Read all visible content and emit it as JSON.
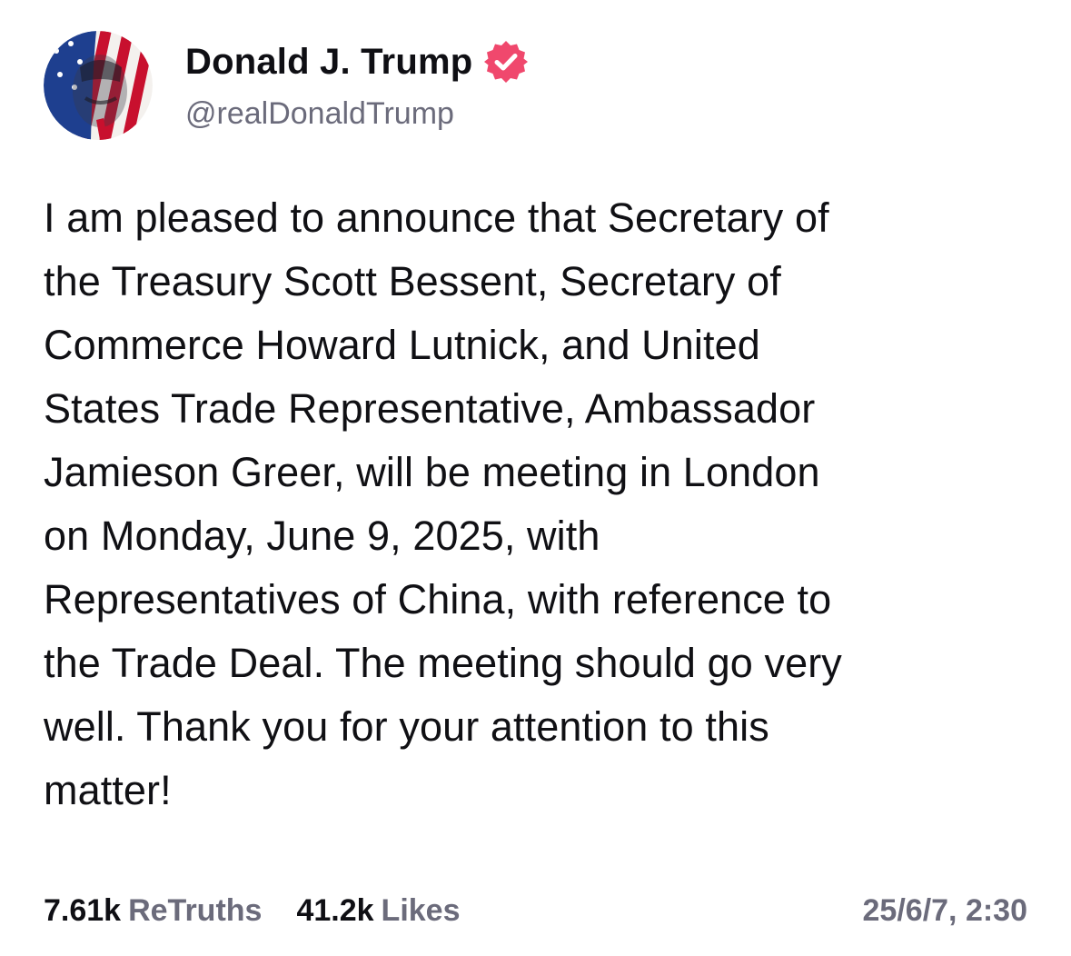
{
  "author": {
    "display_name": "Donald J. Trump",
    "handle": "@realDonaldTrump",
    "verified_color": "#f0486d"
  },
  "post": {
    "text": "I am pleased to announce that Secretary of\nthe Treasury Scott Bessent, Secretary of\nCommerce Howard Lutnick, and United\nStates Trade Representative, Ambassador\nJamieson Greer, will be meeting in London\non Monday, June 9, 2025, with\nRepresentatives of China, with reference to\nthe Trade Deal. The meeting should go very\nwell. Thank you for your attention to this\nmatter!"
  },
  "stats": {
    "retruths_count": "7.61k",
    "retruths_label": "ReTruths",
    "likes_count": "41.2k",
    "likes_label": "Likes",
    "timestamp": "25/6/7, 2:30"
  },
  "icons": {
    "avatar": "avatar-image",
    "verified": "verified-badge-icon"
  }
}
